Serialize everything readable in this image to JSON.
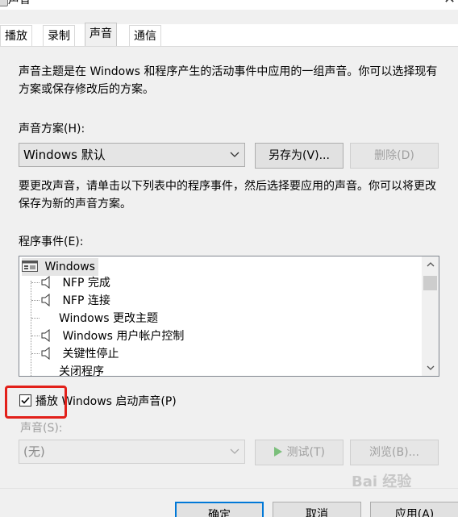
{
  "window": {
    "title": "声音",
    "close_symbol": "✕"
  },
  "tabs": [
    {
      "label": "播放",
      "active": false
    },
    {
      "label": "录制",
      "active": false
    },
    {
      "label": "声音",
      "active": true
    },
    {
      "label": "通信",
      "active": false
    }
  ],
  "intro_text": "声音主题是在 Windows 和程序产生的活动事件中应用的一组声音。你可以选择现有方案或保存修改后的方案。",
  "scheme": {
    "label": "声音方案(H):",
    "selected": "Windows 默认",
    "save_as_label": "另存为(V)...",
    "delete_label": "删除(D)"
  },
  "instructions_text": "要更改声音，请单击以下列表中的程序事件，然后选择要应用的声音。你可以将更改保存为新的声音方案。",
  "events": {
    "label": "程序事件(E):",
    "root": "Windows",
    "items": [
      {
        "label": "NFP 完成",
        "has_sound": true
      },
      {
        "label": "NFP 连接",
        "has_sound": true
      },
      {
        "label": "Windows 更改主题",
        "has_sound": false
      },
      {
        "label": "Windows 用户帐户控制",
        "has_sound": true
      },
      {
        "label": "关键性停止",
        "has_sound": true
      },
      {
        "label": "关闭程序",
        "has_sound": false
      }
    ]
  },
  "play_startup": {
    "label": "播放 Windows 启动声音(P)",
    "checked": true
  },
  "sound": {
    "label": "声音(S):",
    "selected": "(无)",
    "test_label": "测试(T)",
    "browse_label": "浏览(B)..."
  },
  "footer": {
    "ok_label": "确定",
    "cancel_label": "取消",
    "apply_label": "应用(A)"
  },
  "watermark": "Bai 经验",
  "colors": {
    "accent": "#0078d7",
    "highlight_box": "#e2201a",
    "disabled_text": "#a0a0a0",
    "play_icon": "#7bbf7b"
  },
  "icons": {
    "sound": "speaker-icon",
    "root": "windows-root-icon",
    "play": "play-icon",
    "dropdown": "chevron-down-icon"
  }
}
